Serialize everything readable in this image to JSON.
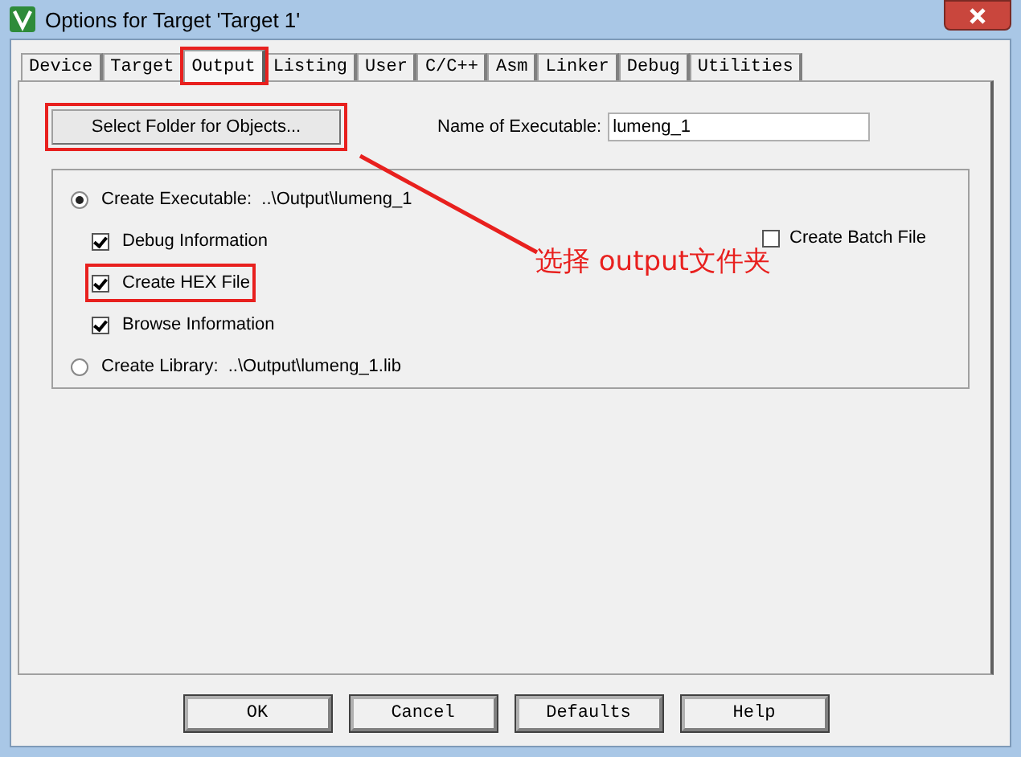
{
  "window": {
    "title": "Options for Target 'Target 1'"
  },
  "tabs": [
    {
      "label": "Device",
      "selected": false,
      "highlighted": false
    },
    {
      "label": "Target",
      "selected": false,
      "highlighted": false
    },
    {
      "label": "Output",
      "selected": true,
      "highlighted": true
    },
    {
      "label": "Listing",
      "selected": false,
      "highlighted": false
    },
    {
      "label": "User",
      "selected": false,
      "highlighted": false
    },
    {
      "label": "C/C++",
      "selected": false,
      "highlighted": false
    },
    {
      "label": "Asm",
      "selected": false,
      "highlighted": false
    },
    {
      "label": "Linker",
      "selected": false,
      "highlighted": false
    },
    {
      "label": "Debug",
      "selected": false,
      "highlighted": false
    },
    {
      "label": "Utilities",
      "selected": false,
      "highlighted": false
    }
  ],
  "select_folder_button": {
    "label": "Select Folder for Objects...",
    "highlighted": true
  },
  "executable_name": {
    "label": "Name of Executable:",
    "value": "lumeng_1"
  },
  "options": [
    {
      "kind": "radio",
      "label": "Create Executable:  ..\\Output\\lumeng_1",
      "selected": true,
      "highlighted": false
    },
    {
      "kind": "checkbox",
      "label": "Debug Information",
      "checked": true,
      "highlighted": false
    },
    {
      "kind": "checkbox",
      "label": "Create HEX File",
      "checked": true,
      "highlighted": true
    },
    {
      "kind": "checkbox",
      "label": "Browse Information",
      "checked": true,
      "highlighted": false
    },
    {
      "kind": "radio",
      "label": "Create Library:  ..\\Output\\lumeng_1.lib",
      "selected": false,
      "highlighted": false
    }
  ],
  "batch_file": {
    "label": "Create Batch File",
    "checked": false
  },
  "annotation": {
    "text": "选择 output文件夹"
  },
  "buttons": [
    "OK",
    "Cancel",
    "Defaults",
    "Help"
  ]
}
